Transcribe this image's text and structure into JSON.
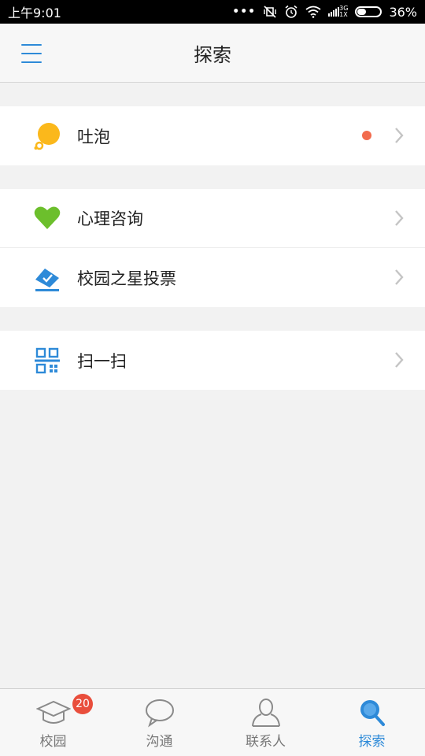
{
  "status_bar": {
    "time": "上午9:01",
    "network_type_top": "3G",
    "network_type_bottom": "1X",
    "battery": "36%"
  },
  "header": {
    "title": "探索",
    "menu_icon": "hamburger-menu-icon"
  },
  "groups": [
    {
      "items": [
        {
          "label": "吐泡",
          "icon": "bubble-icon",
          "icon_color": "#fbb81b",
          "has_dot": true
        }
      ]
    },
    {
      "items": [
        {
          "label": "心理咨询",
          "icon": "heart-icon",
          "icon_color": "#6cbf2c",
          "has_dot": false
        },
        {
          "label": "校园之星投票",
          "icon": "vote-ticket-icon",
          "icon_color": "#2e8ad8",
          "has_dot": false
        }
      ]
    },
    {
      "items": [
        {
          "label": "扫一扫",
          "icon": "qr-scan-icon",
          "icon_color": "#2e8ad8",
          "has_dot": false
        }
      ]
    }
  ],
  "tabbar": {
    "tabs": [
      {
        "label": "校园",
        "icon": "graduation-cap-icon",
        "badge": "20",
        "active": false
      },
      {
        "label": "沟通",
        "icon": "chat-bubble-icon",
        "badge": null,
        "active": false
      },
      {
        "label": "联系人",
        "icon": "contacts-person-icon",
        "badge": null,
        "active": false
      },
      {
        "label": "探索",
        "icon": "search-magnifier-icon",
        "badge": null,
        "active": true
      }
    ]
  },
  "colors": {
    "accent": "#2e8ad8",
    "dot": "#f26b4d",
    "badge": "#e94e3c",
    "background": "#f2f2f2"
  }
}
